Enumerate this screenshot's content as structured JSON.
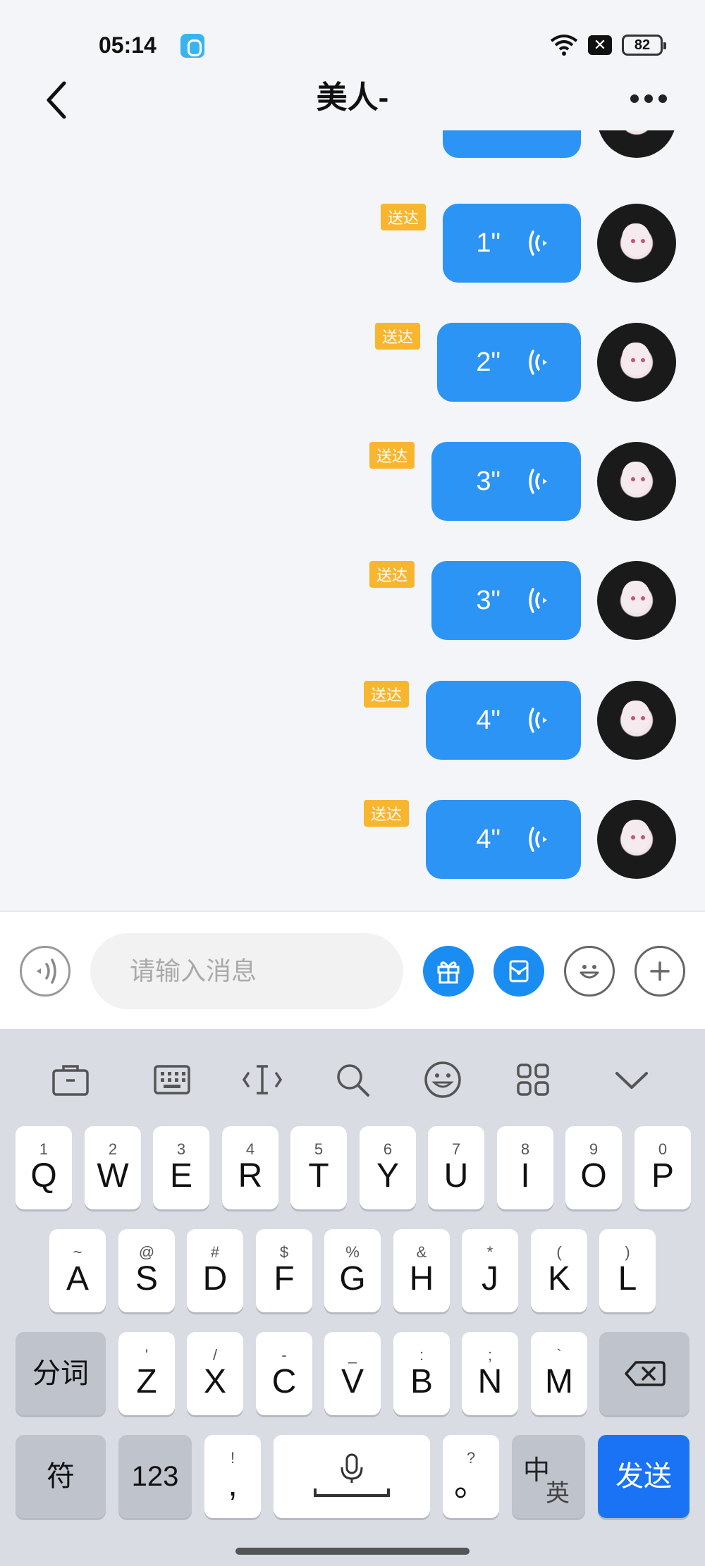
{
  "status_bar": {
    "time": "05:14",
    "battery": "82",
    "x_badge": "✕"
  },
  "header": {
    "title": "美人-"
  },
  "messages": [
    {
      "duration": "1\"",
      "status": "送达"
    },
    {
      "duration": "2\"",
      "status": "送达"
    },
    {
      "duration": "3\"",
      "status": "送达"
    },
    {
      "duration": "3\"",
      "status": "送达"
    },
    {
      "duration": "4\"",
      "status": "送达"
    },
    {
      "duration": "4\"",
      "status": "送达"
    }
  ],
  "input": {
    "placeholder": "请输入消息"
  },
  "keyboard": {
    "row1": [
      {
        "hint": "1",
        "key": "Q"
      },
      {
        "hint": "2",
        "key": "W"
      },
      {
        "hint": "3",
        "key": "E"
      },
      {
        "hint": "4",
        "key": "R"
      },
      {
        "hint": "5",
        "key": "T"
      },
      {
        "hint": "6",
        "key": "Y"
      },
      {
        "hint": "7",
        "key": "U"
      },
      {
        "hint": "8",
        "key": "I"
      },
      {
        "hint": "9",
        "key": "O"
      },
      {
        "hint": "0",
        "key": "P"
      }
    ],
    "row2": [
      {
        "hint": "~",
        "key": "A"
      },
      {
        "hint": "@",
        "key": "S"
      },
      {
        "hint": "#",
        "key": "D"
      },
      {
        "hint": "$",
        "key": "F"
      },
      {
        "hint": "%",
        "key": "G"
      },
      {
        "hint": "&",
        "key": "H"
      },
      {
        "hint": "*",
        "key": "J"
      },
      {
        "hint": "(",
        "key": "K"
      },
      {
        "hint": ")",
        "key": "L"
      }
    ],
    "row3": [
      {
        "hint": "'",
        "key": "Z"
      },
      {
        "hint": "/",
        "key": "X"
      },
      {
        "hint": "-",
        "key": "C"
      },
      {
        "hint": "_",
        "key": "V"
      },
      {
        "hint": ":",
        "key": "B"
      },
      {
        "hint": ";",
        "key": "N"
      },
      {
        "hint": "`",
        "key": "M"
      }
    ],
    "segment_label": "分词",
    "symbols_label": "符",
    "numbers_label": "123",
    "comma": {
      "hint": "!",
      "key": ","
    },
    "period": {
      "hint": "?",
      "key": "。"
    },
    "lang_zh": "中",
    "lang_en": "英",
    "send_label": "发送"
  },
  "colors": {
    "bubble": "#2c94f5",
    "status_tag": "#f8b62f",
    "send_key": "#1a73f5",
    "keyboard_bg": "#d9dce3"
  }
}
